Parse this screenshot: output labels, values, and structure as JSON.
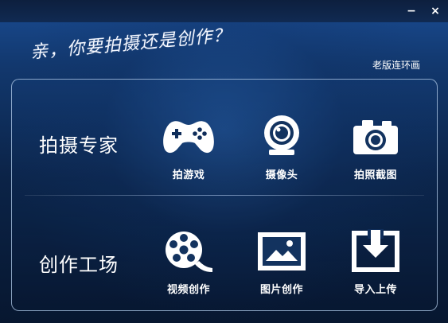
{
  "window": {
    "controls": {
      "minimize_label": "−",
      "close_label": "×"
    }
  },
  "header": {
    "tagline": "亲，你要拍摄还是创作？",
    "old_version_link": "老版连环画"
  },
  "sections": [
    {
      "title": "拍摄专家",
      "items": [
        {
          "label": "拍游戏",
          "icon": "gamepad-icon"
        },
        {
          "label": "摄像头",
          "icon": "webcam-icon"
        },
        {
          "label": "拍照截图",
          "icon": "camera-icon"
        }
      ]
    },
    {
      "title": "创作工场",
      "items": [
        {
          "label": "视频创作",
          "icon": "film-reel-icon"
        },
        {
          "label": "图片创作",
          "icon": "picture-icon"
        },
        {
          "label": "导入上传",
          "icon": "import-icon"
        }
      ]
    }
  ],
  "colors": {
    "background_top": "#1a4c93",
    "background_bottom": "#071730",
    "panel_border": "#b4cdeb",
    "text": "#ffffff"
  }
}
